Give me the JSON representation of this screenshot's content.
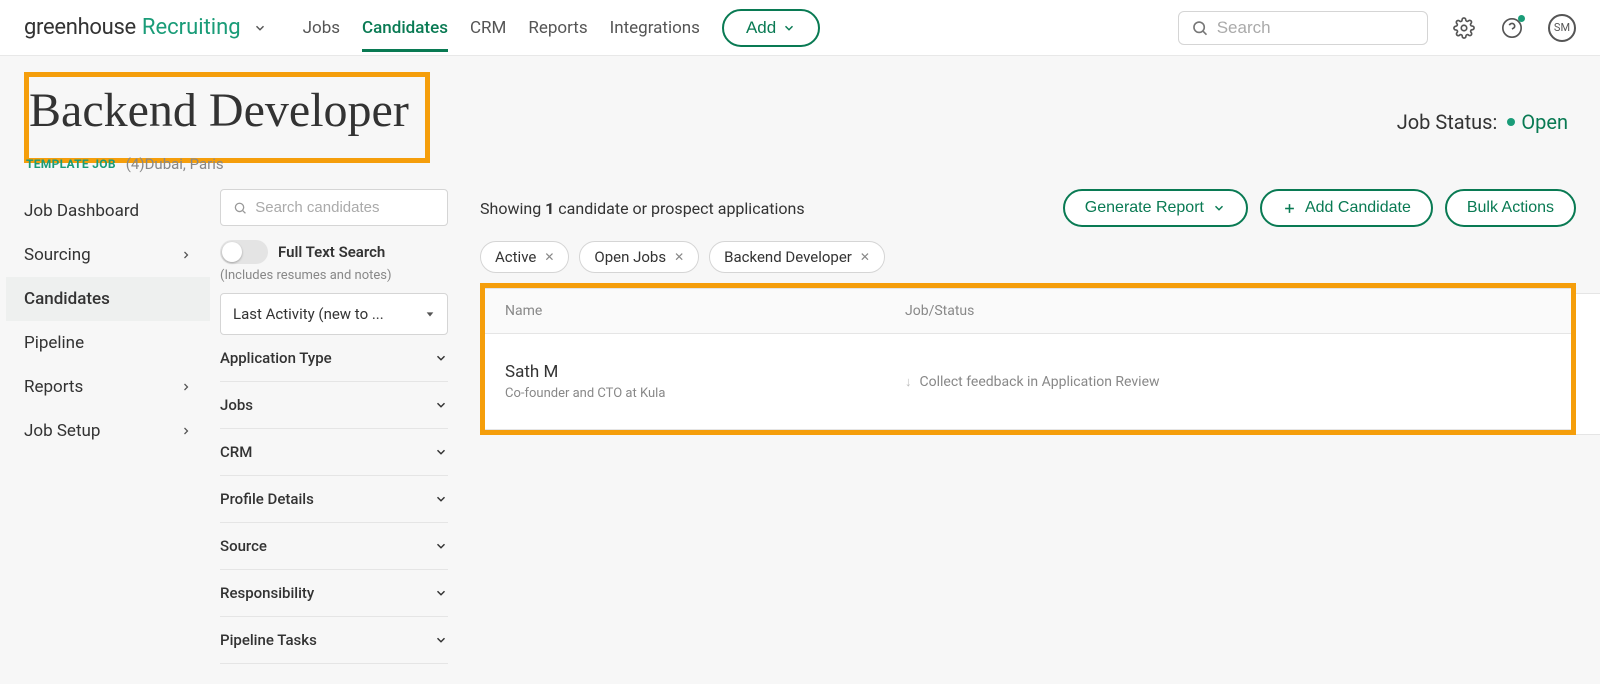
{
  "logo": {
    "part1": "greenhouse",
    "part2": " Recruiting"
  },
  "nav": {
    "items": [
      "Jobs",
      "Candidates",
      "CRM",
      "Reports",
      "Integrations"
    ],
    "activeIndex": 1
  },
  "addBtn": "Add",
  "searchPlaceholder": "Search",
  "avatarInitials": "SM",
  "page": {
    "title": "Backend Developer",
    "templateBadge": "TEMPLATE JOB",
    "locationPrefix": "(4)",
    "locations": "Dubai, Paris",
    "jobStatusLabel": "Job Status:",
    "jobStatusValue": "Open"
  },
  "sidebar": {
    "items": [
      {
        "label": "Job Dashboard",
        "hasChevron": false
      },
      {
        "label": "Sourcing",
        "hasChevron": true
      },
      {
        "label": "Candidates",
        "hasChevron": false
      },
      {
        "label": "Pipeline",
        "hasChevron": false
      },
      {
        "label": "Reports",
        "hasChevron": true
      },
      {
        "label": "Job Setup",
        "hasChevron": true
      }
    ],
    "activeIndex": 2
  },
  "filters": {
    "searchPlaceholder": "Search candidates",
    "fullTextLabel": "Full Text Search",
    "fullTextNote": "(Includes resumes and notes)",
    "sortLabel": "Last Activity (new to ...",
    "sections": [
      "Application Type",
      "Jobs",
      "CRM",
      "Profile Details",
      "Source",
      "Responsibility",
      "Pipeline Tasks"
    ]
  },
  "main": {
    "showingPrefix": "Showing ",
    "showingCount": "1",
    "showingSuffix": " candidate or prospect applications",
    "generateReport": "Generate Report",
    "addCandidate": "Add Candidate",
    "bulkActions": "Bulk Actions",
    "chips": [
      "Active",
      "Open Jobs",
      "Backend Developer"
    ],
    "columns": {
      "name": "Name",
      "status": "Job/Status"
    },
    "rows": [
      {
        "name": "Sath M",
        "subtitle": "Co-founder and CTO at Kula",
        "status": "Collect feedback in Application Review"
      }
    ]
  }
}
